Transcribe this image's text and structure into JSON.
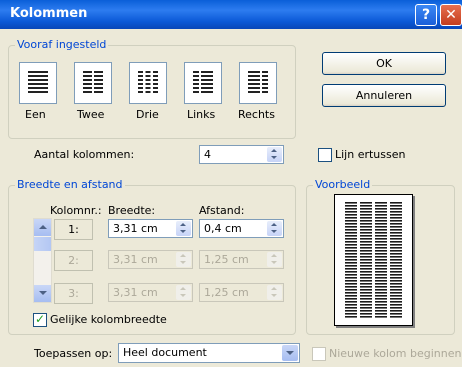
{
  "window": {
    "title": "Kolommen",
    "help_label": "?",
    "close_label": "✕"
  },
  "presets": {
    "group_label": "Vooraf ingesteld",
    "items": [
      {
        "label": "Een",
        "icon": "one-column-icon"
      },
      {
        "label": "Twee",
        "icon": "two-columns-icon"
      },
      {
        "label": "Drie",
        "icon": "three-columns-icon"
      },
      {
        "label": "Links",
        "icon": "left-columns-icon"
      },
      {
        "label": "Rechts",
        "icon": "right-columns-icon"
      }
    ]
  },
  "buttons": {
    "ok": "OK",
    "cancel": "Annuleren"
  },
  "column_count": {
    "label": "Aantal kolommen:",
    "value": "4"
  },
  "line_between": {
    "label": "Lijn ertussen",
    "checked": false
  },
  "width_spacing": {
    "group_label": "Breedte en afstand",
    "headers": {
      "column": "Kolomnr.:",
      "width": "Breedte:",
      "spacing": "Afstand:"
    },
    "rows": [
      {
        "col": "1:",
        "width": "3,31 cm",
        "spacing": "0,4 cm",
        "enabled": true
      },
      {
        "col": "2:",
        "width": "3,31 cm",
        "spacing": "1,25 cm",
        "enabled": false
      },
      {
        "col": "3:",
        "width": "3,31 cm",
        "spacing": "1,25 cm",
        "enabled": false
      }
    ],
    "equal_width": {
      "label": "Gelijke kolombreedte",
      "checked": true
    }
  },
  "preview": {
    "group_label": "Voorbeeld",
    "columns": 4
  },
  "apply": {
    "label": "Toepassen op:",
    "value": "Heel document"
  },
  "new_column": {
    "label": "Nieuwe kolom beginnen",
    "checked": false,
    "enabled": false
  },
  "colors": {
    "title_bar": "#0a5fd8",
    "group_label": "#0046d5",
    "dialog_bg": "#ece9d8",
    "checkmark": "#21a121"
  }
}
